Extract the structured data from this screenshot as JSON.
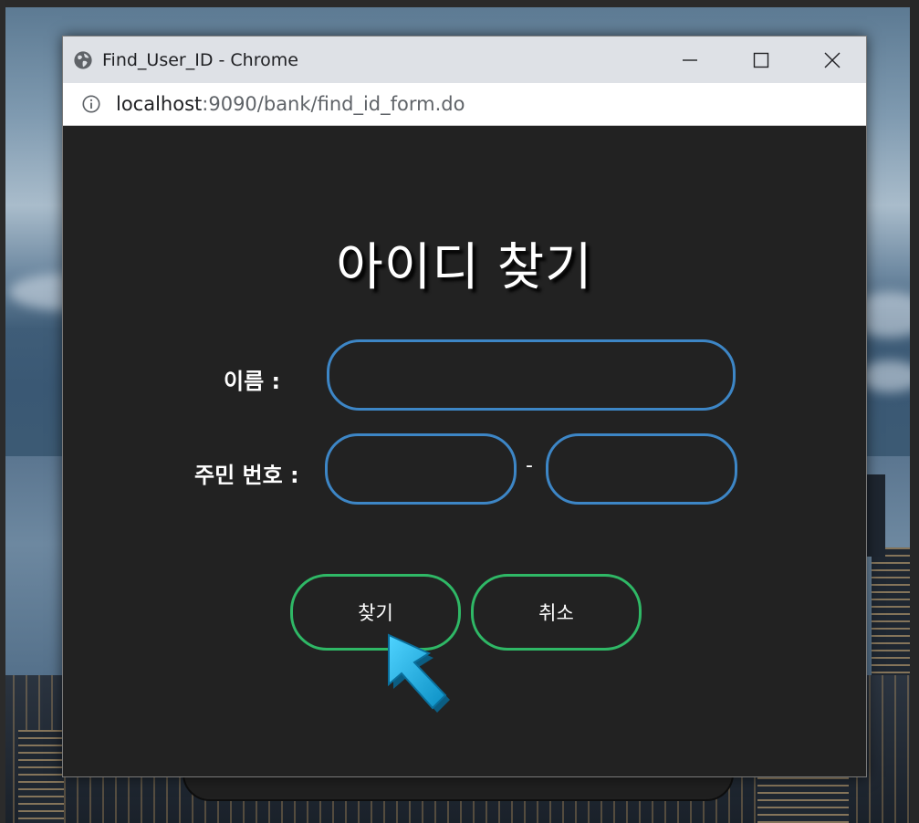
{
  "window": {
    "title": "Find_User_ID - Chrome",
    "url_host": "localhost",
    "url_rest": ":9090/bank/find_id_form.do"
  },
  "form": {
    "title": "아이디 찾기",
    "name_label": "이름 :",
    "name_value": "",
    "ssn_label": "주민 번호 :",
    "ssn_front_value": "",
    "ssn_back_value": "",
    "ssn_separator": "-"
  },
  "buttons": {
    "find": "찾기",
    "cancel": "취소"
  },
  "colors": {
    "input_border": "#3d86c6",
    "button_border": "#2fb866",
    "page_background": "#222222",
    "cursor": "#1eb4e6"
  },
  "icons": {
    "title": "globe-icon",
    "address": "info-icon",
    "minimize": "minimize-icon",
    "maximize": "maximize-icon",
    "close": "close-icon",
    "pointer": "arrow-cursor-icon"
  }
}
